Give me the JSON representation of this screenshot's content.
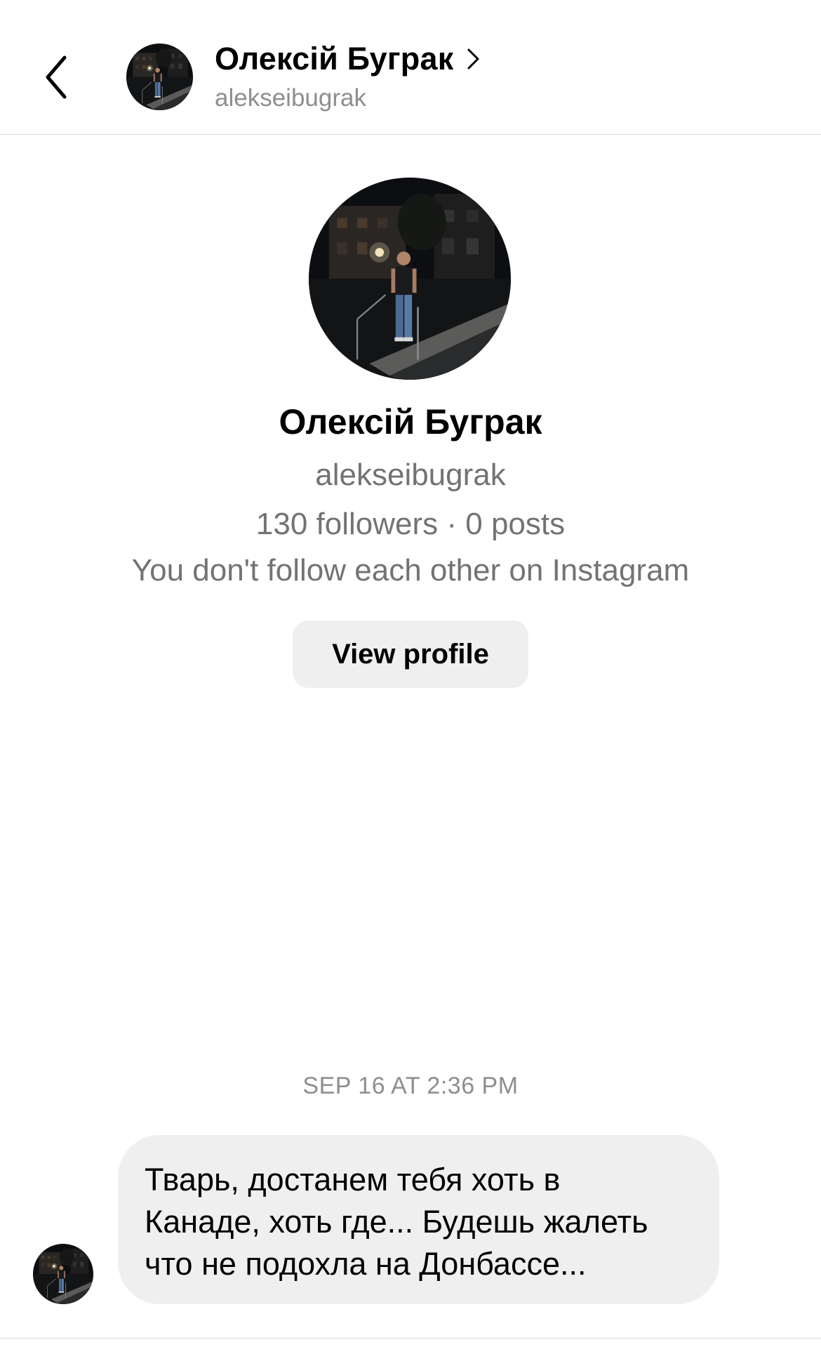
{
  "header": {
    "back_icon": "chevron-left-icon",
    "name": "Олексій Буграк",
    "chevron_icon": "chevron-right-icon",
    "username": "alekseibugrak"
  },
  "profile": {
    "name": "Олексій Буграк",
    "username": "alekseibugrak",
    "stats": "130 followers · 0 posts",
    "follow_note": "You don't follow each other on Instagram",
    "view_profile_label": "View profile"
  },
  "thread": {
    "timestamp": "SEP 16 AT 2:36 PM",
    "messages": [
      {
        "text": "Тварь, достанем тебя хоть в\nКанаде, хоть где... Будешь жалеть\nчто не подохла на Донбассе..."
      }
    ]
  }
}
